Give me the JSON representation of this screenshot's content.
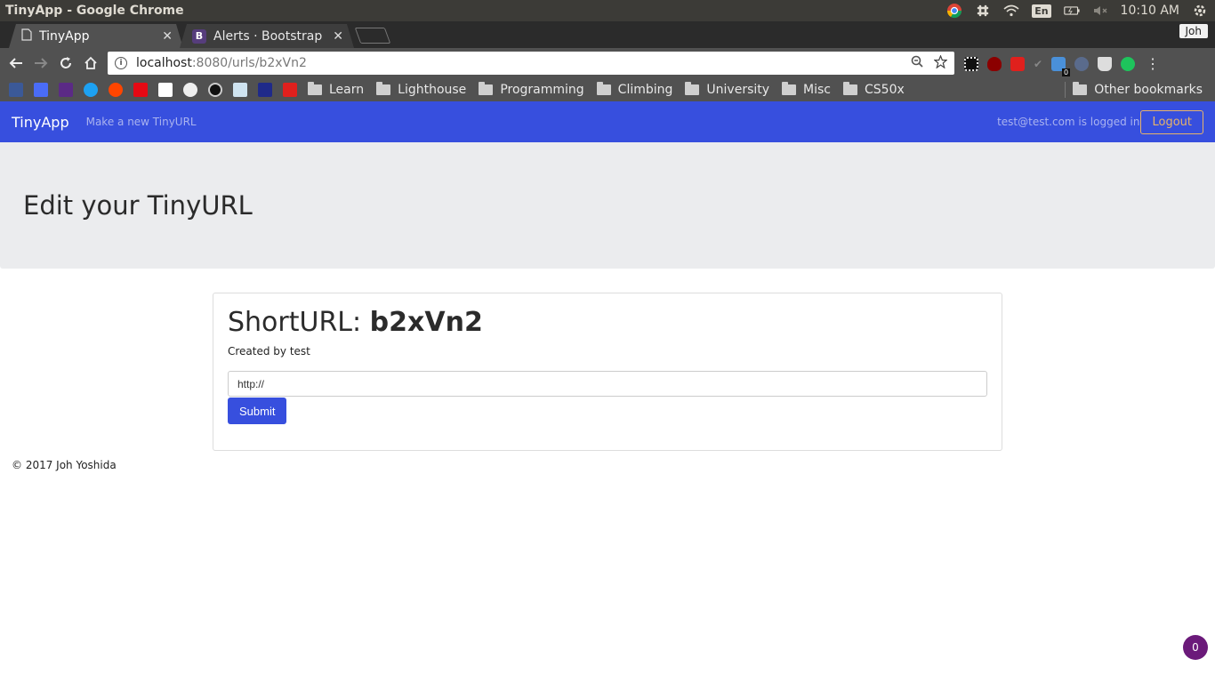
{
  "os": {
    "window_title": "TinyApp - Google Chrome",
    "lang": "En",
    "clock": "10:10 AM"
  },
  "browser": {
    "tabs": [
      {
        "label": "TinyApp",
        "active": true
      },
      {
        "label": "Alerts · Bootstrap",
        "active": false
      }
    ],
    "profile": "Joh",
    "url_host": "localhost",
    "url_path": ":8080/urls/b2xVn2",
    "bookmark_folders": [
      "Learn",
      "Lighthouse",
      "Programming",
      "Climbing",
      "University",
      "Misc",
      "CS50x"
    ],
    "other_bookmarks": "Other bookmarks",
    "ext_badge": "0"
  },
  "navbar": {
    "brand": "TinyApp",
    "new_link": "Make a new TinyURL",
    "logged_in_text": "test@test.com is logged in",
    "logout_label": "Logout"
  },
  "jumbotron": {
    "title": "Edit your TinyURL"
  },
  "card": {
    "title_prefix": "ShortURL: ",
    "short_url": "b2xVn2",
    "created_by": "Created by test",
    "input_value": "http://",
    "submit_label": "Submit"
  },
  "footer": {
    "text": "© 2017 Joh Yoshida"
  },
  "fab_count": "0",
  "colors": {
    "navbar": "#374fde",
    "logout_accent": "#e7b36a",
    "jumbotron_bg": "#ebecee"
  }
}
